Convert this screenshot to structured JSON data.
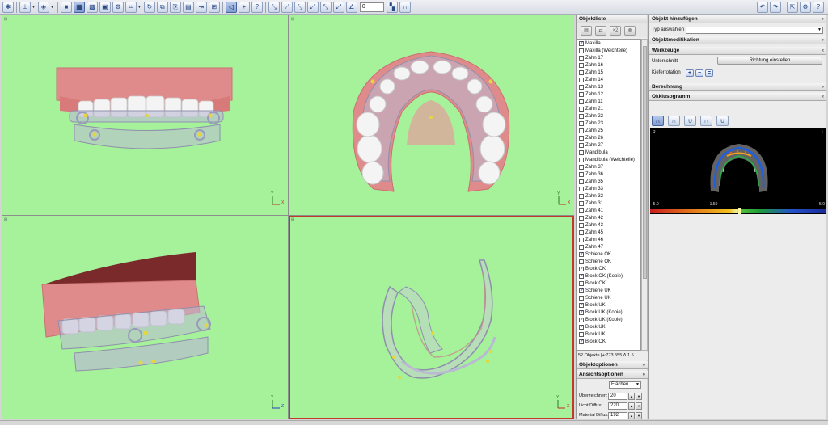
{
  "toolbar": {
    "spin_value": "0",
    "icons_left": [
      "layout-icon",
      "drop",
      "cube-icon",
      "drop",
      "single-view-icon",
      "quad-view-icon",
      "grid-view-icon",
      "folder-open-icon",
      "folder-gear-icon",
      "frame-icon",
      "drop",
      "rotate-left-icon",
      "copy-icon",
      "copy-link-icon",
      "folder-doc-icon",
      "folder-arrow-icon",
      "folder-node-icon",
      "lasso-icon",
      "plus-arrow-icon",
      "plus-question-icon",
      "measure-icon",
      "measure2-icon",
      "measure3-icon",
      "measure4-icon",
      "cursor-icon"
    ],
    "icons_right": [
      "undo-icon",
      "redo-icon",
      "export-icon",
      "settings-icon",
      "help-icon"
    ]
  },
  "viewports": {
    "tl_axis": [
      "Y",
      "X"
    ],
    "tr_axis": [
      "Y",
      "X"
    ],
    "bl_axis": [
      "Y",
      "Z"
    ],
    "br_axis": [
      "Y",
      "X"
    ]
  },
  "objektliste": {
    "title": "Objektliste",
    "items": [
      {
        "label": "Maxilla",
        "checked": true
      },
      {
        "label": "Maxilla (Weichteile)",
        "checked": false
      },
      {
        "label": "Zahn 17",
        "checked": false
      },
      {
        "label": "Zahn 16",
        "checked": false
      },
      {
        "label": "Zahn 15",
        "checked": false
      },
      {
        "label": "Zahn 14",
        "checked": false
      },
      {
        "label": "Zahn 13",
        "checked": false
      },
      {
        "label": "Zahn 12",
        "checked": false
      },
      {
        "label": "Zahn 11",
        "checked": false
      },
      {
        "label": "Zahn 21",
        "checked": false
      },
      {
        "label": "Zahn 22",
        "checked": false
      },
      {
        "label": "Zahn 23",
        "checked": false
      },
      {
        "label": "Zahn 25",
        "checked": false
      },
      {
        "label": "Zahn 26",
        "checked": false
      },
      {
        "label": "Zahn 27",
        "checked": false
      },
      {
        "label": "Mandibula",
        "checked": false
      },
      {
        "label": "Mandibula (Weichteile)",
        "checked": false
      },
      {
        "label": "Zahn 37",
        "checked": false
      },
      {
        "label": "Zahn 36",
        "checked": false
      },
      {
        "label": "Zahn 35",
        "checked": false
      },
      {
        "label": "Zahn 33",
        "checked": false
      },
      {
        "label": "Zahn 32",
        "checked": false
      },
      {
        "label": "Zahn 31",
        "checked": false
      },
      {
        "label": "Zahn 41",
        "checked": false
      },
      {
        "label": "Zahn 42",
        "checked": false
      },
      {
        "label": "Zahn 43",
        "checked": false
      },
      {
        "label": "Zahn 45",
        "checked": false
      },
      {
        "label": "Zahn 46",
        "checked": false
      },
      {
        "label": "Zahn 47",
        "checked": false
      },
      {
        "label": "Schiene OK",
        "checked": true
      },
      {
        "label": "Schiene OK",
        "checked": false
      },
      {
        "label": "Block OK",
        "checked": true
      },
      {
        "label": "Block OK (Kopie)",
        "checked": true
      },
      {
        "label": "Block OK",
        "checked": false
      },
      {
        "label": "Schiene UK",
        "checked": true
      },
      {
        "label": "Schiene UK",
        "checked": false
      },
      {
        "label": "Block UK",
        "checked": true
      },
      {
        "label": "Block UK (Kopie)",
        "checked": true
      },
      {
        "label": "Block UK (Kopie)",
        "checked": true
      },
      {
        "label": "Block UK",
        "checked": true
      },
      {
        "label": "Block UK",
        "checked": false
      },
      {
        "label": "Block OK",
        "checked": true
      }
    ],
    "status": "52 Objekte  [+:773.555 Δ:1.5..."
  },
  "objektoptionen": {
    "title": "Objektoptionen"
  },
  "ansichtsoptionen": {
    "title": "Ansichtsoptionen",
    "mode": "Flächen",
    "rows": [
      {
        "label": "Überzeichnen:",
        "value": "20"
      },
      {
        "label": "Licht Diffus:",
        "value": "220"
      },
      {
        "label": "Material Diffus:",
        "value": "192"
      }
    ]
  },
  "right": {
    "objekt_hinzufuegen": "Objekt hinzufügen",
    "typ_label": "Typ auswählen",
    "typ_value": "",
    "objektmodifikation": "Objektmodifikation",
    "werkzeuge": "Werkzeuge",
    "unterschnitt_label": "Unterschnitt",
    "richtung_button": "Richtung einstellen",
    "kieferrotation_label": "Kieferrotation",
    "kr_buttons": [
      "+",
      "−",
      "="
    ],
    "berechnung": "Berechnung",
    "okklusogramm": "Okklusogramm",
    "occl_left": "R",
    "occl_right": "L",
    "scale_min": "-5.0",
    "scale_mid": "-1.50",
    "scale_max": "5.0"
  },
  "colors": {
    "viewport_bg": "#a6f29b",
    "selected_border": "#c13a2a",
    "gum": "#e08b8b",
    "tooth": "#f3f3f3",
    "splint": "#b9b9d3",
    "marker": "#e6d63a"
  }
}
